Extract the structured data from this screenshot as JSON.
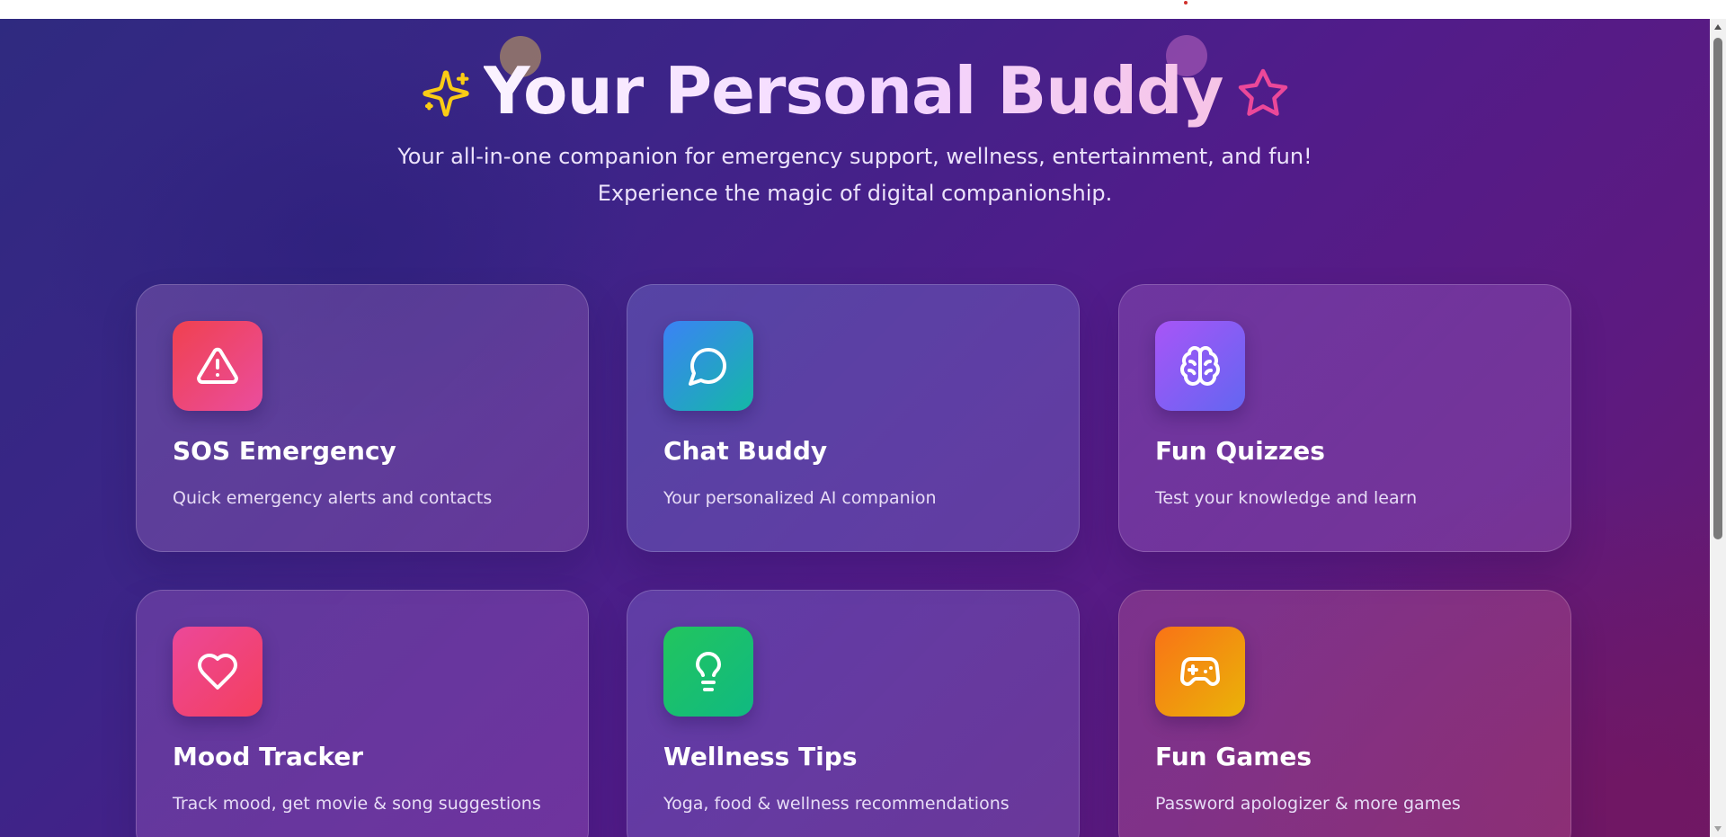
{
  "hero": {
    "title": "Your Personal Buddy",
    "sparkle_icon": "sparkles-icon",
    "star_icon": "star-icon",
    "subtitle_line1": "Your all-in-one companion for emergency support, wellness, entertainment, and fun!",
    "subtitle_line2": "Experience the magic of digital companionship."
  },
  "features": [
    {
      "title": "SOS Emergency",
      "description": "Quick emergency alerts and contacts",
      "icon": "alert-triangle-icon",
      "colors": [
        "#f0414f",
        "#ea4d9e"
      ]
    },
    {
      "title": "Chat Buddy",
      "description": "Your personalized AI companion",
      "icon": "message-circle-icon",
      "colors": [
        "#3b82f6",
        "#14b8a6"
      ]
    },
    {
      "title": "Fun Quizzes",
      "description": "Test your knowledge and learn",
      "icon": "brain-icon",
      "colors": [
        "#a855f7",
        "#6366f1"
      ]
    },
    {
      "title": "Mood Tracker",
      "description": "Track mood, get movie & song suggestions",
      "icon": "heart-icon",
      "colors": [
        "#ec4899",
        "#f43f5e"
      ]
    },
    {
      "title": "Wellness Tips",
      "description": "Yoga, food & wellness recommendations",
      "icon": "lightbulb-icon",
      "colors": [
        "#22c55e",
        "#10b981"
      ]
    },
    {
      "title": "Fun Games",
      "description": "Password apologizer & more games",
      "icon": "gamepad-icon",
      "colors": [
        "#f97316",
        "#eab308"
      ]
    }
  ],
  "colors": {
    "background_start": "#2f2a80",
    "background_end": "#6a1a6a",
    "sparkle": "#facc15",
    "star": "#ec4899"
  }
}
